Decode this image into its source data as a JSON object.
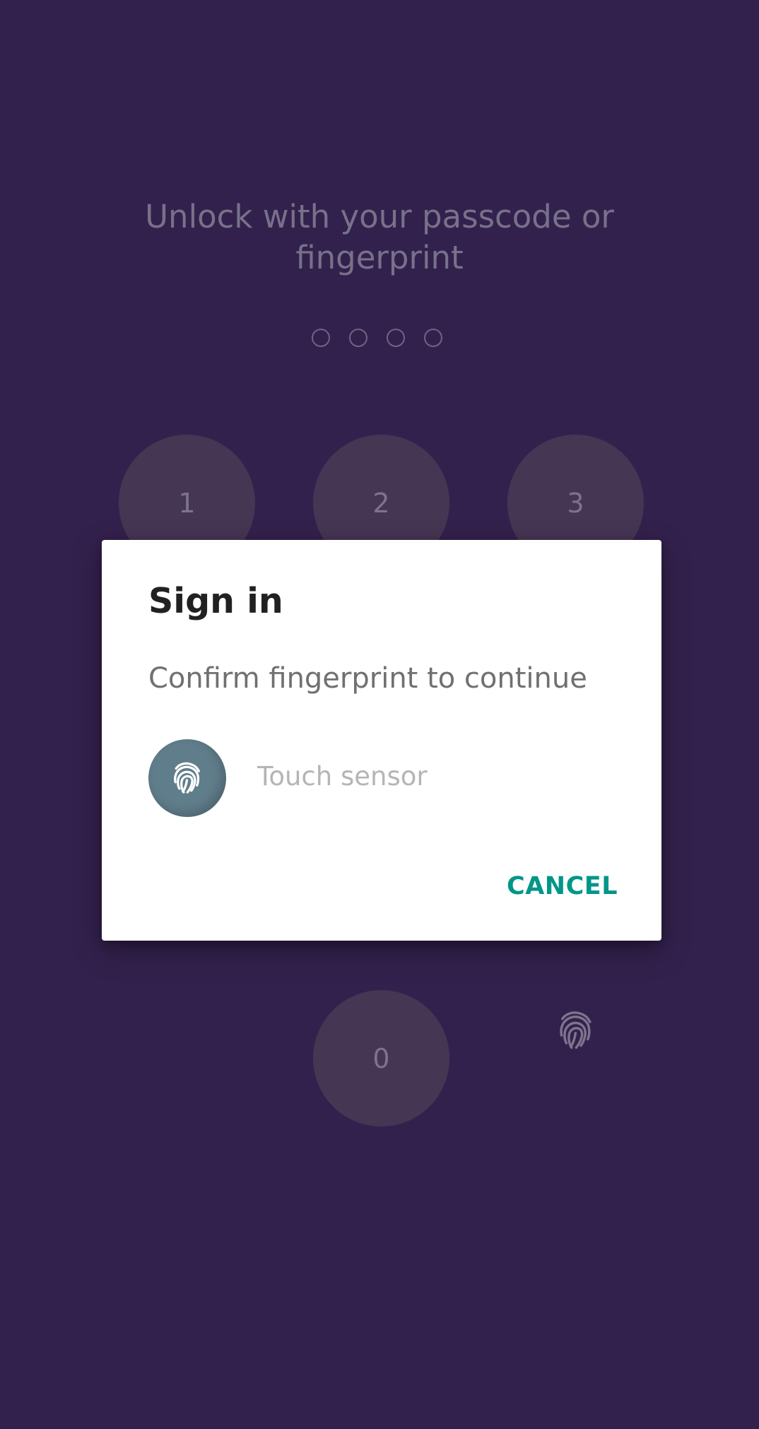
{
  "lock_screen": {
    "prompt": "Unlock with your passcode or fingerprint",
    "keypad": {
      "key_1": "1",
      "key_2": "2",
      "key_3": "3",
      "key_0": "0"
    },
    "background_color": "#33214d"
  },
  "dialog": {
    "title": "Sign in",
    "description": "Confirm fingerprint to continue",
    "sensor_label": "Touch sensor",
    "cancel_label": "CANCEL",
    "accent_color": "#009688"
  },
  "icons": {
    "fingerprint": "fingerprint-icon"
  }
}
